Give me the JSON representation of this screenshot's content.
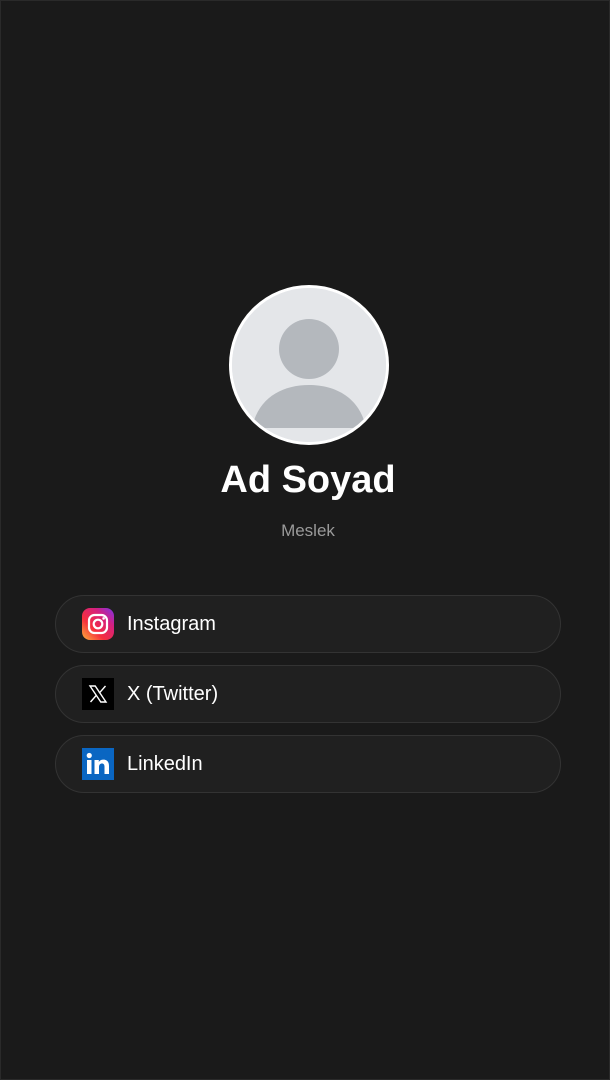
{
  "profile": {
    "name": "Ad Soyad",
    "profession": "Meslek"
  },
  "links": [
    {
      "label": "Instagram",
      "icon": "instagram-icon"
    },
    {
      "label": "X (Twitter)",
      "icon": "x-twitter-icon"
    },
    {
      "label": "LinkedIn",
      "icon": "linkedin-icon"
    }
  ],
  "colors": {
    "background": "#1a1a1a",
    "card": "#202020",
    "card_border": "#333333",
    "text": "#ffffff",
    "muted": "#9a9a9a",
    "linkedin": "#0a66c2"
  }
}
